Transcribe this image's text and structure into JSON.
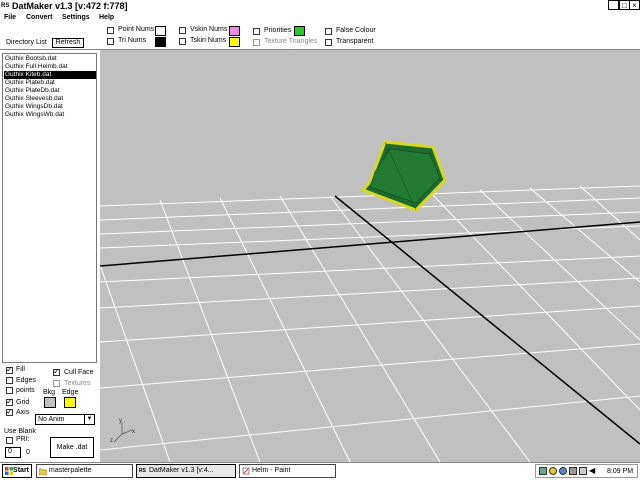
{
  "window": {
    "title": "DatMaker v1.3  [v:472 f:778]",
    "app_icon": "RS",
    "controls": [
      "_",
      "□",
      "×"
    ]
  },
  "menu": [
    "File",
    "Convert",
    "Settings",
    "Help"
  ],
  "toolbar": {
    "point_nums": "Point Nums",
    "tri_nums": "Tri Nums",
    "vskin_nums": "Vskin Nums",
    "tskin_nums": "Tskin Nums",
    "priorities": "Priorities",
    "texture_triangles": "Texture Triangles",
    "false_colour": "False Colour",
    "transparent": "Transparent",
    "colors": {
      "point_nums": "#ffffff",
      "tri_nums": "#000000",
      "vskin_nums": "#f08ce8",
      "tskin_nums": "#ffff00",
      "priorities": "#22cc22"
    }
  },
  "directory": {
    "label": "Directory List",
    "refresh": "Refresh",
    "files": [
      "Guthix Bootsb.dat",
      "Guthix Full Helmb.dat",
      "Guthix Kiteb.dat",
      "Guthix Plateb.dat",
      "Guthix PlateDb.dat",
      "Guthix Sleevesb.dat",
      "Guthix WingsDb.dat",
      "Guthix WingsWb.dat"
    ],
    "selected_index": 2
  },
  "options": {
    "fill": "Fill",
    "cull_face": "Cull Face",
    "edges": "Edges",
    "textures": "Textures",
    "points": "points",
    "grid": "Grid",
    "axis": "Axis",
    "bkg": "Bkg",
    "edge": "Edge",
    "bkg_color": "#c0c0c0",
    "edge_color": "#ffff00",
    "anim_selected": "No Anim",
    "use_blank": "Use Blank",
    "pri": "PRI:",
    "pri_value": "0",
    "pri_value2": "0",
    "make_dat": "Make .dat"
  },
  "viewport": {
    "axis_x": "x",
    "axis_y": "y",
    "axis_z": "z",
    "model_color": "#1e6b2e",
    "edge_color": "#d8d820",
    "grid_color": "#ffffff",
    "bg_color": "#c0c0c0"
  },
  "taskbar": {
    "start": "Start",
    "tasks": [
      "masterpalette",
      "DatMaker v1.3  [v:4...",
      "Helm - Paint"
    ],
    "clock": "8:09 PM"
  }
}
